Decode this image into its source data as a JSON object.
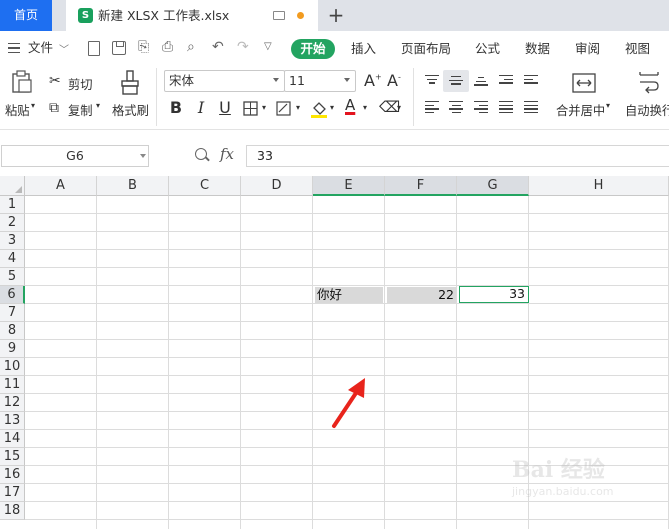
{
  "tabs": {
    "home": "首页",
    "file": "新建 XLSX 工作表.xlsx",
    "file_icon": "S",
    "new_tab": "+"
  },
  "menu": {
    "file": "文件",
    "items": [
      "开始",
      "插入",
      "页面布局",
      "公式",
      "数据",
      "审阅",
      "视图"
    ]
  },
  "ribbon": {
    "paste": "粘贴",
    "cut": "剪切",
    "copy": "复制",
    "format_painter": "格式刷",
    "font": "宋体",
    "size": "11",
    "bold": "B",
    "italic": "I",
    "underline": "U",
    "merge": "合并居中",
    "wrap": "自动换行"
  },
  "formula_bar": {
    "name_box": "G6",
    "fx": "fx",
    "value": "33"
  },
  "sheet": {
    "columns": [
      "A",
      "B",
      "C",
      "D",
      "E",
      "F",
      "G",
      "H"
    ],
    "rows": [
      "1",
      "2",
      "3",
      "4",
      "5",
      "6",
      "7",
      "8",
      "9",
      "10",
      "11",
      "12",
      "13",
      "14",
      "15",
      "16",
      "17",
      "18"
    ],
    "selected_cell": "G6",
    "cells": {
      "E6": "你好",
      "F6": "22",
      "G6": "33"
    }
  },
  "watermark": {
    "text": "Bai 经验",
    "subtext": "jingyan.baidu.com"
  },
  "colors": {
    "accent_green": "#23a461",
    "tab_blue": "#1e6ff1",
    "arrow_red": "#e8241c",
    "cell_fill": "#d9d9d9"
  }
}
